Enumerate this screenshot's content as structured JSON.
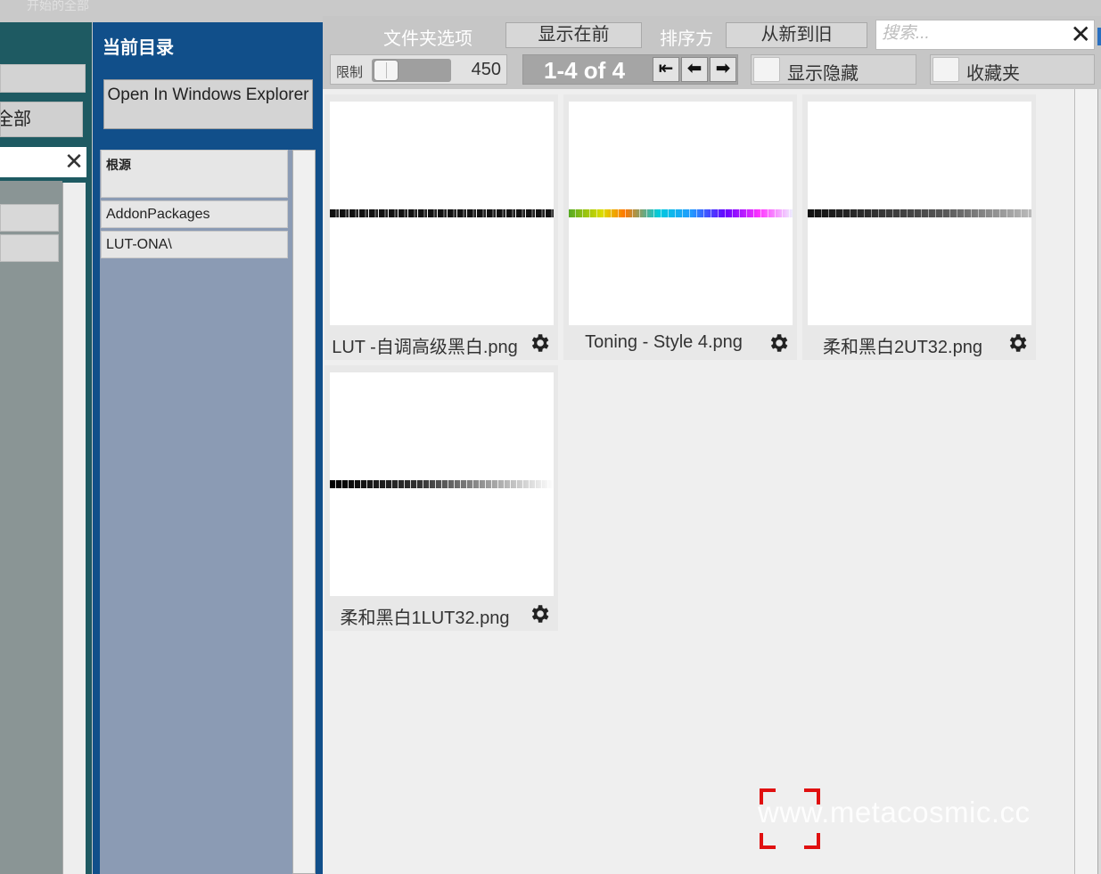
{
  "top_strip_text": "开始的全部",
  "left_panel": {
    "all_button_label": "全部"
  },
  "folder_panel": {
    "title": "当前目录",
    "open_button_label": "Open In Windows Explorer",
    "tree": {
      "root_label": "根源",
      "items": [
        "AddonPackages",
        "LUT-ONA\\"
      ]
    }
  },
  "toolbar": {
    "folder_options_label": "文件夹选项",
    "show_first_label": "显示在前",
    "sort_label": "排序方",
    "sort_value": "从新到旧",
    "search_placeholder": "搜索...",
    "limit_label": "限制",
    "limit_value": "450",
    "limit_fraction": 0.18,
    "page_info": "1-4 of 4",
    "show_hidden_label": "显示隐藏",
    "favorites_label": "收藏夹"
  },
  "files": [
    {
      "name": "LUT -自调高级黑白.png",
      "strip": "bw"
    },
    {
      "name": "Toning - Style 4.png",
      "strip": "color"
    },
    {
      "name": "柔和黑白2UT32.png",
      "strip": "bw2"
    },
    {
      "name": "柔和黑白1LUT32.png",
      "strip": "fade"
    }
  ],
  "watermark": "www.metacosmic.cc",
  "colors": {
    "folder_panel_bg": "#114f8a",
    "tree_bg": "#8b9bb4",
    "left_panel_bg": "#1e5a62",
    "grid_bg": "#efefef",
    "corner_mark": "#e01010"
  }
}
